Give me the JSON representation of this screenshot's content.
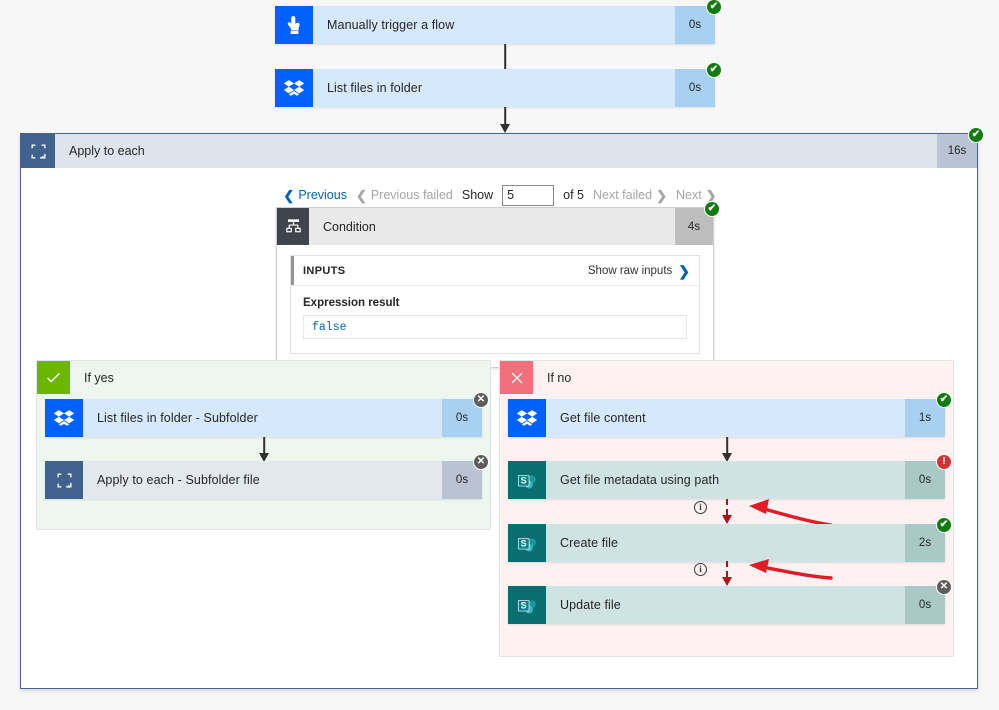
{
  "flow": {
    "trigger": {
      "name": "manually-trigger-a-flow",
      "label": "Manually trigger a flow",
      "duration": "0s",
      "status": "succeeded",
      "icon": "tap-hand-icon"
    },
    "list_files": {
      "label": "List files in folder",
      "duration": "0s",
      "status": "succeeded",
      "icon": "dropbox-icon"
    },
    "apply_to_each": {
      "label": "Apply to each",
      "duration": "16s",
      "status": "succeeded",
      "icon": "loop-icon"
    }
  },
  "pagination": {
    "previous": "Previous",
    "previous_failed": "Previous failed",
    "show_label": "Show",
    "show_value": "5",
    "of_label": "of 5",
    "next_failed": "Next failed",
    "next": "Next"
  },
  "condition": {
    "label": "Condition",
    "duration": "4s",
    "status": "succeeded",
    "icon": "condition-fork-icon",
    "inputs_label": "INPUTS",
    "show_raw_inputs": "Show raw inputs",
    "expression_label": "Expression result",
    "expression_value": "false"
  },
  "branch_yes": {
    "label": "If yes",
    "icon": "checkmark-icon",
    "actions": [
      {
        "label": "List files in folder - Subfolder",
        "duration": "0s",
        "status": "skipped",
        "icon": "dropbox-icon",
        "theme": "t-dropbox"
      },
      {
        "label": "Apply to each - Subfolder file",
        "duration": "0s",
        "status": "skipped",
        "icon": "loop-icon",
        "theme": "t-loop"
      }
    ]
  },
  "branch_no": {
    "label": "If no",
    "icon": "cross-icon",
    "actions": [
      {
        "label": "Get file content",
        "duration": "1s",
        "status": "succeeded",
        "icon": "dropbox-icon",
        "theme": "t-dropbox"
      },
      {
        "label": "Get file metadata using path",
        "duration": "0s",
        "status": "failed",
        "icon": "sharepoint-icon",
        "theme": "t-sharepoint"
      },
      {
        "label": "Create file",
        "duration": "2s",
        "status": "succeeded",
        "icon": "sharepoint-icon",
        "theme": "t-sharepoint"
      },
      {
        "label": "Update file",
        "duration": "0s",
        "status": "skipped",
        "icon": "sharepoint-icon",
        "theme": "t-sharepoint"
      }
    ],
    "run_after_info_icon": "info-circle-icon",
    "annotation_icon": "red-arrow-annotation"
  },
  "status_glyphs": {
    "succeeded": "✔",
    "failed": "!",
    "skipped": "✕"
  },
  "colors": {
    "dropbox": "#0061ff",
    "sharepoint": "#0a6e71",
    "loop": "#41618f",
    "condition": "#40444d",
    "yes_green": "#6bb700",
    "no_red": "#f1707b",
    "succeeded": "#107c10",
    "failed": "#d13438",
    "skipped": "#5d5d5d",
    "annotation_red": "#e01b24",
    "link_blue": "#0063b1"
  }
}
